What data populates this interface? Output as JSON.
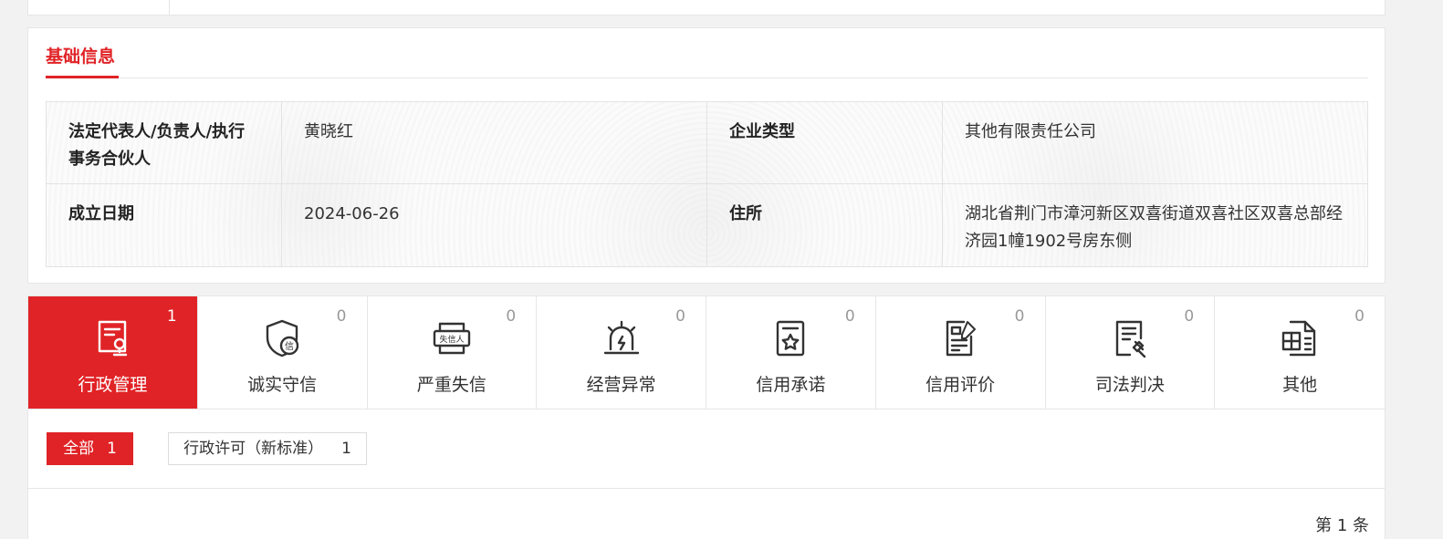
{
  "basic_info": {
    "section_title": "基础信息",
    "rows": [
      {
        "label1": "法定代表人/负责人/执行事务合伙人",
        "value1": "黄晓红",
        "label2": "企业类型",
        "value2": "其他有限责任公司"
      },
      {
        "label1": "成立日期",
        "value1": "2024-06-26",
        "label2": "住所",
        "value2": "湖北省荆门市漳河新区双喜街道双喜社区双喜总部经济园1幢1902号房东侧"
      }
    ]
  },
  "category_tabs": [
    {
      "label": "行政管理",
      "count": "1",
      "icon": "document-stamp-icon",
      "active": true
    },
    {
      "label": "诚实守信",
      "count": "0",
      "icon": "shield-credit-icon",
      "active": false
    },
    {
      "label": "严重失信",
      "count": "0",
      "icon": "dishonest-person-icon",
      "active": false
    },
    {
      "label": "经营异常",
      "count": "0",
      "icon": "alarm-light-icon",
      "active": false
    },
    {
      "label": "信用承诺",
      "count": "0",
      "icon": "star-document-icon",
      "active": false
    },
    {
      "label": "信用评价",
      "count": "0",
      "icon": "evaluation-pen-icon",
      "active": false
    },
    {
      "label": "司法判决",
      "count": "0",
      "icon": "gavel-document-icon",
      "active": false
    },
    {
      "label": "其他",
      "count": "0",
      "icon": "other-documents-icon",
      "active": false
    }
  ],
  "filters": {
    "all_label": "全部",
    "all_count": "1",
    "permit_label": "行政许可（新标准）",
    "permit_count": "1"
  },
  "pagination": {
    "text": "第 1 条"
  },
  "colors": {
    "accent": "#e02326",
    "border": "#e6e6e6",
    "background": "#f2f2f2"
  }
}
